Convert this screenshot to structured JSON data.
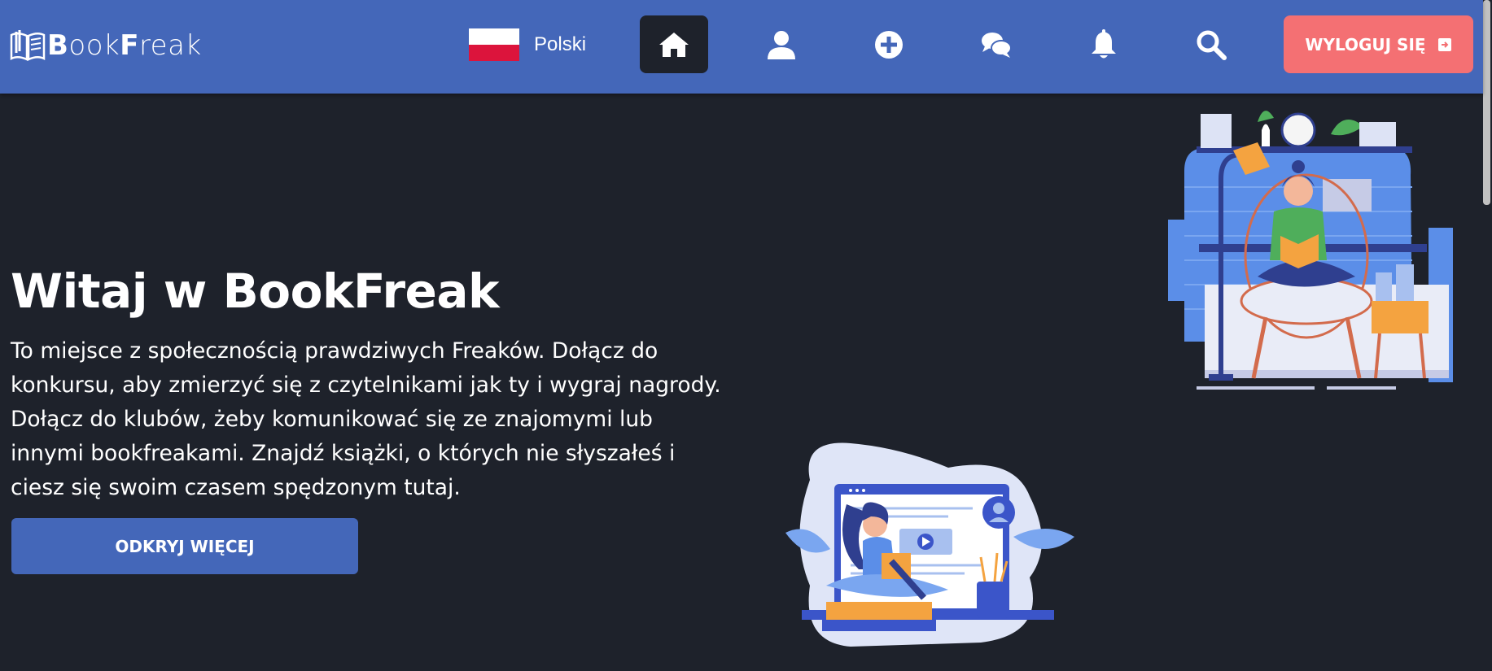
{
  "navbar": {
    "logo": {
      "text_bold_1": "B",
      "text_1": "ook",
      "text_bold_2": "F",
      "text_2": "reak"
    },
    "language": {
      "label": "Polski"
    },
    "icons": [
      "home-icon",
      "user-icon",
      "add-circle-icon",
      "chat-icon",
      "bell-icon",
      "search-icon"
    ],
    "logout_label": "WYLOGUJ SIĘ"
  },
  "hero": {
    "title": "Witaj w BookFreak",
    "description": "To miejsce z społecznością prawdziwych Freaków. Dołącz do konkursu, aby zmierzyć się z czytelnikami jak ty i wygraj nagrody. Dołącz do klubów, żeby komunikować się ze znajomymi lub innymi bookfreakami. Znajdź książki, o których nie słyszałeś i ciesz się swoim czasem spędzonym tutaj.",
    "cta_label": "ODKRYJ WIĘCEJ"
  },
  "colors": {
    "navbar": "#4467b9",
    "background": "#1e222b",
    "logout": "#f47073",
    "active_nav": "#1e222b"
  }
}
